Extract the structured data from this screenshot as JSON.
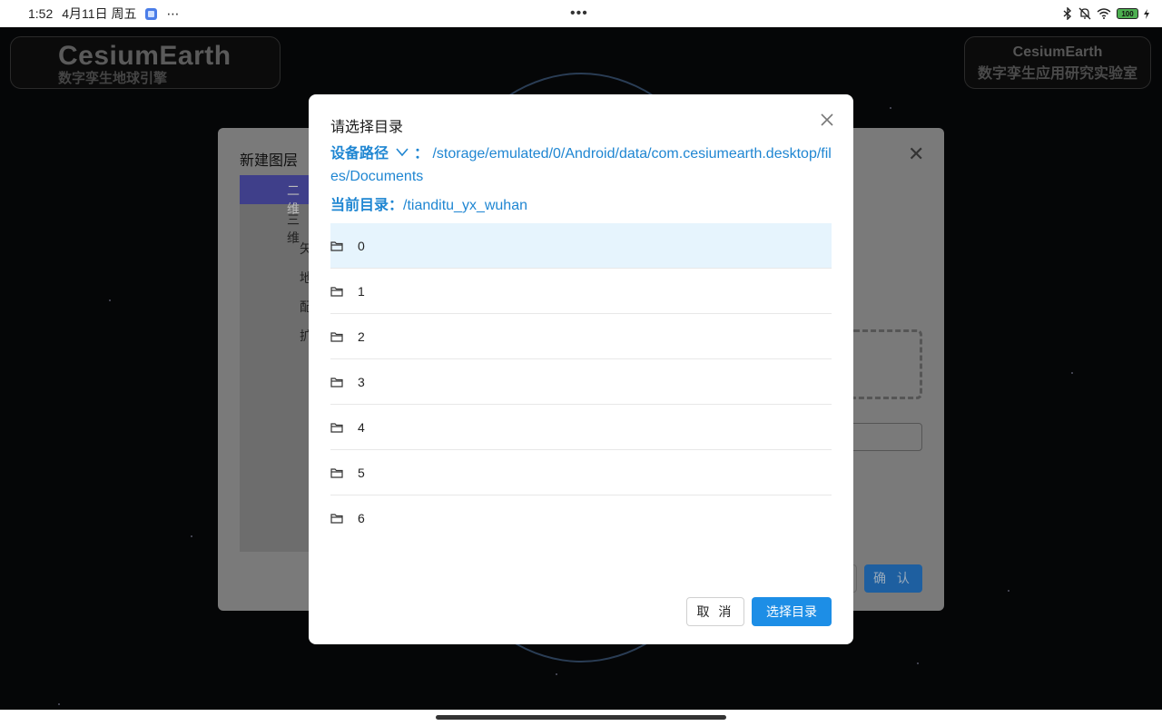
{
  "status_bar": {
    "time": "1:52",
    "date": "4月11日 周五",
    "more": "⋯",
    "center_dots": "•••",
    "battery": "100"
  },
  "background": {
    "logo_title": "CesiumEarth",
    "logo_subtitle": "数字孪生地球引擎",
    "lab_title": "CesiumEarth",
    "lab_subtitle": "数字孪生应用研究实验室",
    "dialog_title": "新建图层",
    "tree_items": [
      "二维",
      "三维",
      "矢",
      "地",
      "配",
      "扩"
    ],
    "confirm_label": "确 认"
  },
  "modal": {
    "title": "请选择目录",
    "device_path_label": "设备路径",
    "device_path_sep": "：",
    "device_path": "/storage/emulated/0/Android/data/com.cesiumearth.desktop/files/Documents",
    "current_dir_label": "当前目录：",
    "current_dir": "/tianditu_yx_wuhan",
    "folders": [
      "0",
      "1",
      "2",
      "3",
      "4",
      "5",
      "6"
    ],
    "cancel_label": "取 消",
    "select_label": "选择目录"
  },
  "colors": {
    "accent": "#1d8ee6",
    "link": "#1f86d2",
    "selected_row": "#e6f4fd"
  }
}
